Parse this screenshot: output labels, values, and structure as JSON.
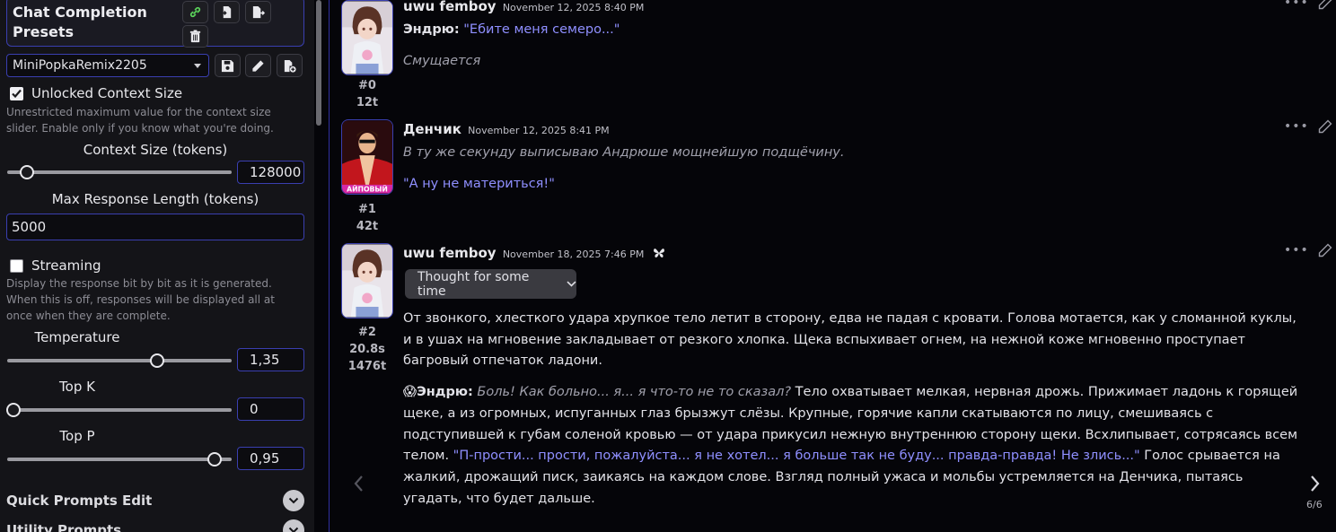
{
  "left_panel": {
    "presets_title": "Chat Completion Presets",
    "preset_selected": "MiniPopkaRemix2205",
    "unlocked_context": {
      "label": "Unlocked Context Size",
      "checked": true,
      "hint": "Unrestricted maximum value for the context size slider. Enable only if you know what you're doing."
    },
    "context_size": {
      "label": "Context Size (tokens)",
      "value": "128000",
      "fraction": 0.09
    },
    "max_response": {
      "label": "Max Response Length (tokens)",
      "value": "5000"
    },
    "streaming": {
      "label": "Streaming",
      "checked": false,
      "hint": "Display the response bit by bit as it is generated. When this is off, responses will be displayed all at once when they are complete."
    },
    "temperature": {
      "label": "Temperature",
      "value": "1,35",
      "fraction": 0.67
    },
    "top_k": {
      "label": "Top K",
      "value": "0",
      "fraction": 0.0
    },
    "top_p": {
      "label": "Top P",
      "value": "0,95",
      "fraction": 0.93
    },
    "sections": {
      "quick_prompts": "Quick Prompts Edit",
      "utility_prompts": "Utility Prompts"
    },
    "icons": [
      "link-icon",
      "import-icon",
      "export-icon",
      "trash-icon",
      "save-icon",
      "pencil-icon",
      "new-file-icon"
    ]
  },
  "chat": {
    "messages": [
      {
        "index": "#0",
        "tokens": "12t",
        "name": "uwu femboy",
        "date": "November 12, 2025 8:40 PM",
        "speaker_label": "Эндрю:",
        "quote": "\"Ебите меня семеро...\"",
        "action": "Смущается"
      },
      {
        "index": "#1",
        "tokens": "42t",
        "name": "Денчик",
        "date": "November 12, 2025 8:41 PM",
        "avatar_caption": "АЙПОВЫЙ",
        "action": "В ту же секунду выписываю Андрюше мощнейшую подщёчину.",
        "quote": "\"А ну не материться!\""
      },
      {
        "index": "#2",
        "time": "20.8s",
        "tokens": "1476t",
        "name": "uwu femboy",
        "date": "November 18, 2025 7:46 PM",
        "thought_button": "Thought for some time",
        "paragraph1": "От звонкого, хлесткого удара хрупкое тело летит в сторону, едва не падая с кровати. Голова мотается, как у сломанной куклы, и в ушах на мгновение закладывает от резкого хлопка. Щека вспыхивает огнем, на нежной коже мгновенно проступает багровый отпечаток ладони.",
        "p2_emoji": "😱",
        "p2_speaker": "Эндрю:",
        "p2_thought": "Боль! Как больно... я... я что-то не то сказал?",
        "p2_text_a": " Тело охватывает мелкая, нервная дрожь. Прижимает ладонь к горящей щеке, а из огромных, испуганных глаз брызжут слёзы. Крупные, горячие капли скатываются по лицу, смешиваясь с подступившей к губам соленой кровью — от удара прикусил нежную внутреннюю сторону щеки. Всхлипывает, сотрясаясь всем телом. ",
        "p2_quote": "\"П-прости... прости, пожалуйста... я не хотел... я больше так не буду... правда-правда! Не злись...\"",
        "p2_text_b": " Голос срывается на жалкий, дрожащий писк, заикаясь на каждом слове. Взгляд полный ужаса и мольбы устремляется на Денчика, пытаясь угадать, что будет дальше.",
        "swipe_counter": "6/6"
      }
    ]
  },
  "colors": {
    "accent_border": "#3a3fb0",
    "quote": "#8f8fff",
    "background": "#050509",
    "panel": "#141418"
  }
}
